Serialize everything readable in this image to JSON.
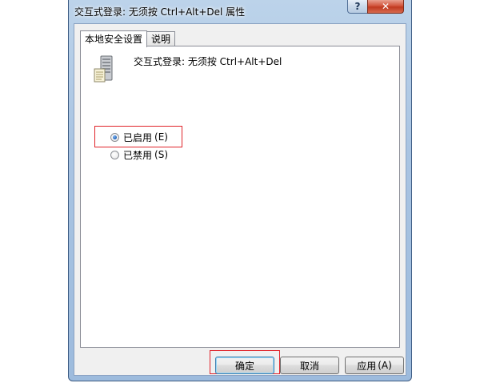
{
  "window": {
    "title": "交互式登录: 无须按 Ctrl+Alt+Del 属性",
    "help_glyph": "?",
    "close_glyph": "✕"
  },
  "tabs": [
    {
      "label": "本地安全设置",
      "active": true
    },
    {
      "label": "说明",
      "active": false
    }
  ],
  "policy": {
    "icon": "server-policy-icon",
    "name": "交互式登录: 无须按 Ctrl+Alt+Del"
  },
  "options": [
    {
      "label": "已启用",
      "shortcut": "(E)",
      "selected": true
    },
    {
      "label": "已禁用",
      "shortcut": "(S)",
      "selected": false
    }
  ],
  "buttons": {
    "ok": "确定",
    "cancel": "取消",
    "apply": "应用",
    "apply_shortcut": "(A)"
  },
  "colors": {
    "highlight": "#e0232a",
    "radio_selected": "#1c5fb8",
    "titlebar": "#a9c4e2",
    "close_button": "#c03a20"
  }
}
